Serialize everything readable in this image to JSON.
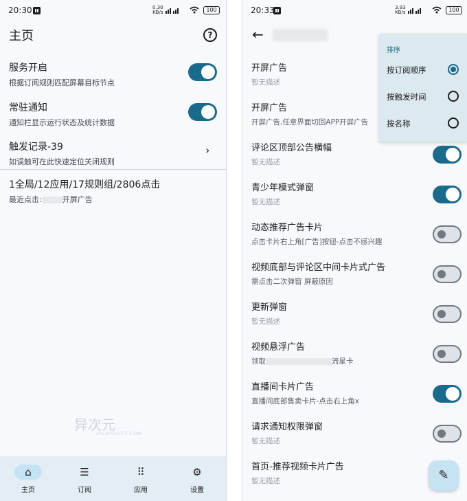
{
  "left": {
    "status": {
      "time": "20:30",
      "speed_top": "0.30",
      "speed_bottom": "KB/s",
      "battery": "100"
    },
    "title": "主页",
    "settings": [
      {
        "title": "服务开启",
        "desc": "根据订阅规则匹配屏幕目标节点",
        "toggle": "on"
      },
      {
        "title": "常驻通知",
        "desc": "通知栏显示运行状态及统计数据",
        "toggle": "on"
      },
      {
        "title": "触发记录-39",
        "desc": "如误触可在此快速定位关闭规则"
      }
    ],
    "stats": {
      "summary": "1全局/12应用/17规则组/2806点击",
      "recent_prefix": "最近点击:",
      "recent_suffix": "开屏广告"
    },
    "watermark": {
      "text": "异次元",
      "sub": "IPLAYSOFT.COM"
    },
    "nav": [
      {
        "label": "主页",
        "icon": "home-icon",
        "glyph": "⌂"
      },
      {
        "label": "订阅",
        "icon": "list-icon",
        "glyph": "☰"
      },
      {
        "label": "应用",
        "icon": "apps-grid-icon",
        "glyph": "⠿"
      },
      {
        "label": "设置",
        "icon": "gear-icon",
        "glyph": "⚙"
      }
    ]
  },
  "right": {
    "status": {
      "time": "20:33",
      "speed_top": "3.93",
      "speed_bottom": "KB/s",
      "battery": "100"
    },
    "sort_menu": {
      "title": "排序",
      "options": [
        {
          "label": "按订阅顺序",
          "selected": true
        },
        {
          "label": "按触发时间",
          "selected": false
        },
        {
          "label": "按名称",
          "selected": false
        }
      ]
    },
    "rules": [
      {
        "title": "开屏广告",
        "desc": "暂无描述",
        "muted": true,
        "toggle": "hidden"
      },
      {
        "title": "开屏广告",
        "desc": "开屏广告,任意界面切回APP开屏广告",
        "muted": false,
        "toggle": "hidden"
      },
      {
        "title": "评论区顶部公告横幅",
        "desc": "暂无描述",
        "muted": true,
        "toggle": "on"
      },
      {
        "title": "青少年模式弹窗",
        "desc": "暂无描述",
        "muted": true,
        "toggle": "on"
      },
      {
        "title": "动态推荐广告卡片",
        "desc": "点击卡片右上角[广告]按钮-点击不感兴趣",
        "muted": false,
        "toggle": "off"
      },
      {
        "title": "视频底部与评论区中间卡片式广告",
        "desc": "需点击二次弹窗 屏蔽原因",
        "muted": false,
        "toggle": "off"
      },
      {
        "title": "更新弹窗",
        "desc": "暂无描述",
        "muted": true,
        "toggle": "off"
      },
      {
        "title": "视频悬浮广告",
        "desc": "领取",
        "desc_suffix": "流星卡",
        "muted": false,
        "toggle": "off"
      },
      {
        "title": "直播间卡片广告",
        "desc": "直播间底部售卖卡片-点击右上角x",
        "muted": false,
        "toggle": "on"
      },
      {
        "title": "请求通知权限弹窗",
        "desc": "暂无描述",
        "muted": true,
        "toggle": "off"
      },
      {
        "title": "首页-推荐视频卡片广告",
        "desc": "暂无描述",
        "muted": true,
        "toggle": "hidden"
      }
    ]
  }
}
